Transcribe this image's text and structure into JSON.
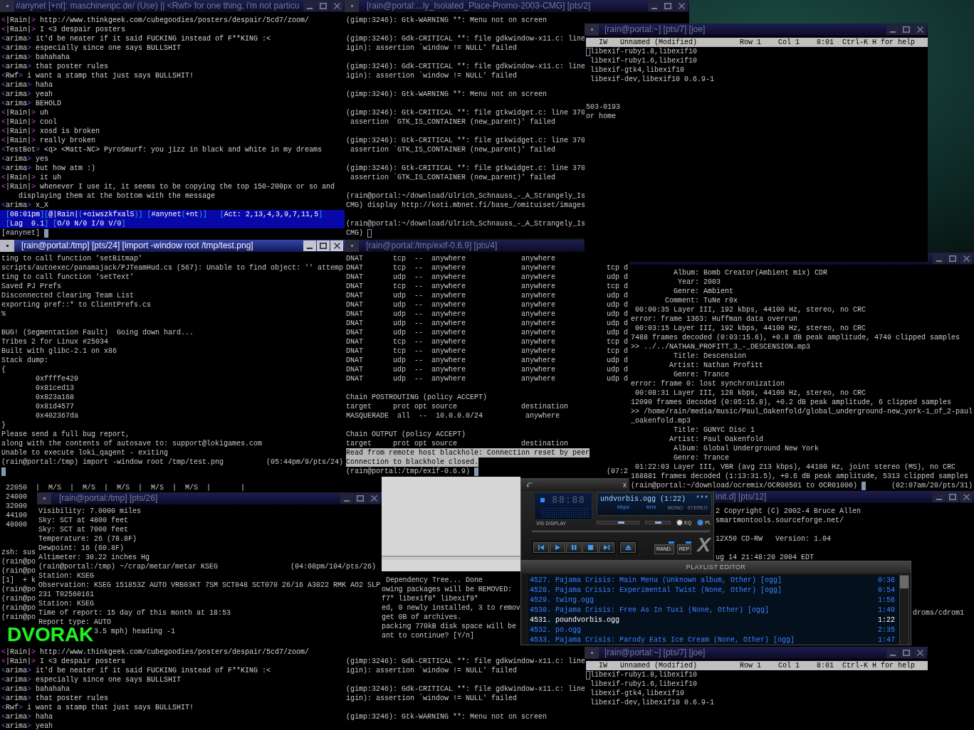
{
  "windows": [
    {
      "kind": "irc",
      "title": "#anynet [+nt]: maschinenpc.de/ (Use) || <Rwf> for one thing, i'm not particu",
      "focused": false,
      "messages": [
        {
          "nick": "<|Rain|>",
          "own": true,
          "text": "http://www.thinkgeek.com/cubegoodies/posters/despair/5cd7/zoom/"
        },
        {
          "nick": "<|Rain|>",
          "own": true,
          "text": "I <3 despair posters"
        },
        {
          "nick": "<arima>",
          "own": false,
          "text": "it'd be neater if it said FUCKING instead of F**KING :<"
        },
        {
          "nick": "<arima>",
          "own": false,
          "text": "especially since one says BULLSHIT"
        },
        {
          "nick": "<arima>",
          "own": false,
          "text": "bahahaha"
        },
        {
          "nick": "<arima>",
          "own": false,
          "text": "that poster rules"
        },
        {
          "nick": "<Rwf>",
          "own": false,
          "text": "i want a stamp that just says BULLSHIT!"
        },
        {
          "nick": "<arima>",
          "own": false,
          "text": "haha"
        },
        {
          "nick": "<arima>",
          "own": false,
          "text": "yeah"
        },
        {
          "nick": "<arima>",
          "own": false,
          "text": "BEHOLD"
        },
        {
          "nick": "<|Rain|>",
          "own": true,
          "text": "uh"
        },
        {
          "nick": "<|Rain|>",
          "own": true,
          "text": "cool"
        },
        {
          "nick": "<|Rain|>",
          "own": true,
          "text": "xosd is broken"
        },
        {
          "nick": "<|Rain|>",
          "own": true,
          "text": "really broken"
        },
        {
          "nick": "<TestBot>",
          "own": false,
          "text": "<q> <Matt-NC> PyroSmurf: you jizz in black and white in my dreams"
        },
        {
          "nick": "<arima>",
          "own": false,
          "text": "yes"
        },
        {
          "nick": "<arima>",
          "own": false,
          "text": "but how atm :)"
        },
        {
          "nick": "<|Rain|>",
          "own": true,
          "text": "it uh"
        },
        {
          "nick": "<|Rain|>",
          "own": true,
          "text": "whenever I use it, it seems to be copying the top 150-200px or so and displaying them at the bottom with the message"
        },
        {
          "nick": "<arima>",
          "own": false,
          "text": "x_X"
        }
      ],
      "status_lines": [
        "[08:01pm][@|Rain|(+oiwszkfxalS)] [#anynet(+nt)]   [Act: 2,13,4,3,9,7,11,5]",
        "[Lag  0.1] [O/0 N/0 I/0 V/0]"
      ],
      "input": {
        "text": "[#anynet]",
        "cursor": true
      }
    },
    {
      "kind": "terminal",
      "title": "[rain@portal:...ly_Isolated_Place-Promo-2003-CMG] [pts/2]",
      "focused": false,
      "blocks": [
        [
          "(gimp:3246): Gtk-WARNING **: Menu not on screen"
        ],
        [
          "(gimp:3246): Gdk-CRITICAL **: file gdkwindow-x11.c: line",
          "igin): assertion `window != NULL' failed"
        ],
        [
          "(gimp:3246): Gdk-CRITICAL **: file gdkwindow-x11.c: line",
          "igin): assertion `window != NULL' failed"
        ],
        [
          "(gimp:3246): Gtk-WARNING **: Menu not on screen"
        ],
        [
          "(gimp:3246): Gtk-CRITICAL **: file gtkwidget.c: line 370",
          " assertion `GTK_IS_CONTAINER (new_parent)' failed"
        ],
        [
          "(gimp:3246): Gtk-CRITICAL **: file gtkwidget.c: line 370",
          " assertion `GTK_IS_CONTAINER (new_parent)' failed"
        ],
        [
          "(gimp:3246): Gtk-CRITICAL **: file gtkwidget.c: line 370",
          " assertion `GTK_IS_CONTAINER (new_parent)' failed"
        ],
        [
          "(rain@portal:~/download/Ulrich_Schnauss_-_A_Strangely_Is",
          "CMG) display http://koti.mbnet.fi/base_/omituiset/images"
        ],
        [
          "(rain@portal:~/download/Ulrich_Schnauss_-_A_Strangely_Is"
        ]
      ],
      "prompt": {
        "text": "CMG)",
        "cursor": true,
        "cursor_below": false,
        "cursor_outline": true
      }
    },
    {
      "kind": "editor",
      "title": "[rain@portal:~] [pts/7] [joe]",
      "focused": false,
      "status_line": "IW   Unnamed (Modified)          Row 1    Col 1    8:01  Ctrl-K H for help",
      "buffer": [
        "libexif-ruby1.8,libexif10",
        "libexif-ruby1.6,libexif10",
        "libexif-gtk4,libexif10",
        "libexif-dev,libexif10 0.6.9-1"
      ],
      "cursor": true,
      "cursor_outline": true,
      "leftover_lines": [
        "503-0193",
        "or home"
      ]
    },
    {
      "kind": "terminal",
      "title": "[rain@portal:/tmp] [pts/24] [import -window root /tmp/test.png]",
      "focused": true,
      "blocks": [
        [
          "ting to call function 'setBitmap'",
          "scripts/autoexec/panamajack/PJTeamHud.cs (567): Unable to find object: '' attemp",
          "ting to call function 'setText'",
          "Saved PJ Prefs",
          "Disconnected Clearing Team List",
          "exporting pref::* to ClientPrefs.cs",
          "%"
        ],
        [
          "BUG! (Segmentation Fault)  Going down hard...",
          "Tribes 2 for Linux #25034",
          "Built with glibc-2.1 on x86",
          "Stack dump:",
          "{",
          "        0xffffe420",
          "        0x81ced13",
          "        0x823a168",
          "        0x81d4577",
          "        0x402367da",
          "}",
          "Please send a full bug report,",
          "along with the contents of autosave to: support@lokigames.com",
          "Unable to execute loki_qagent - exiting"
        ]
      ],
      "prompt": {
        "text": "(rain@portal:/tmp) import -window root /tmp/test.png",
        "time": "(05:44pm/9/pts/24)",
        "cursor": true,
        "cursor_below": true,
        "cursor_outline": false
      }
    },
    {
      "kind": "terminal",
      "title": "[rain@portal:/tmp/exif-0.6.9] [pts/4]",
      "focused": false,
      "blocks": [
        [
          "DNAT       tcp  --  anywhere             anywhere",
          "DNAT       tcp  --  anywhere             anywhere            tcp d",
          "DNAT       udp  --  anywhere             anywhere            udp d",
          "DNAT       tcp  --  anywhere             anywhere            tcp d",
          "DNAT       udp  --  anywhere             anywhere            udp d",
          "DNAT       udp  --  anywhere             anywhere            udp d",
          "DNAT       udp  --  anywhere             anywhere            udp d",
          "DNAT       udp  --  anywhere             anywhere            udp d",
          "DNAT       udp  --  anywhere             anywhere            udp d",
          "DNAT       tcp  --  anywhere             anywhere            tcp d",
          "DNAT       tcp  --  anywhere             anywhere            tcp d",
          "DNAT       udp  --  anywhere             anywhere            udp d",
          "DNAT       udp  --  anywhere             anywhere            udp d",
          "DNAT       udp  --  anywhere             anywhere            udp d"
        ],
        [
          "Chain POSTROUTING (policy ACCEPT)",
          "target     prot opt source               destination",
          "MASQUERADE  all  --  10.0.0.0/24          anywhere"
        ],
        [
          "Chain OUTPUT (policy ACCEPT)",
          "target     prot opt source               destination"
        ]
      ],
      "selected_lines": [
        "Read from remote host blackhole: Connection reset by peer",
        "Connection to blackhole closed."
      ],
      "prompt": {
        "text": "(rain@portal:/tmp/exif-0.6.9)",
        "time": "(07:2",
        "cursor": true,
        "cursor_below": false,
        "cursor_outline": false
      }
    },
    {
      "kind": "terminal",
      "title_bar": true,
      "focused": false,
      "blocks": [
        [
          "          Album: Bomb Creator(Ambient mix) CDR",
          "           Year: 2003",
          "          Genre: Ambient",
          "        Comment: TuNe r0x",
          " 00:00:35 Layer III, 192 kbps, 44100 Hz, stereo, no CRC",
          "error: frame 1363: Huffman data overrun",
          " 00:03:15 Layer III, 192 kbps, 44100 Hz, stereo, no CRC",
          "7488 frames decoded (0:03:15.6), +0.8 dB peak amplitude, 4749 clipped samples",
          ">> ../../NATHAN_PROFITT_3_-_DESCENSION.mp3",
          "          Title: Descension",
          "         Artist: Nathan Profitt",
          "          Genre: Trance",
          "error: frame 0: lost synchronization",
          " 00:08:31 Layer III, 128 kbps, 44100 Hz, stereo, no CRC",
          "12090 frames decoded (0:05:15.8), +0.2 dB peak amplitude, 6 clipped samples",
          ">> /home/rain/media/music/Paul_Oakenfold/global_underground-new_york-1_of_2-paul",
          "_oakenfold.mp3",
          "          Title: GUNYC Disc 1",
          "         Artist: Paul Oakenfold",
          "          Album: Global Underground New York",
          "          Genre: Trance",
          " 01:22:03 Layer III, VBR (avg 213 kbps), 44100 Hz, joint stereo (MS), no CRC",
          "168881 frames decoded (1:13:31.5), +0.6 dB peak amplitude, 5313 clipped samples"
        ]
      ],
      "prompt": {
        "text": "(rain@portal:~/download/ocremix/OCR00501 to OCR01000)",
        "time": "(02:07am/20/pts/31)",
        "cursor": true,
        "cursor_below": false,
        "cursor_outline": false
      }
    },
    {
      "kind": "terminal",
      "blocks": [
        [
          " 22050  |  M/S  |  M/S  |  M/S  |  M/S  |  M/S  |       |",
          " 24000",
          " 32000",
          " 44100",
          " 48000"
        ],
        [
          "zsh: sus",
          "(rain@po",
          "(rain@po",
          "[1]  + k",
          "(rain@po",
          "(rain@po",
          "(rain@po",
          "(rain@po"
        ]
      ]
    },
    {
      "kind": "terminal",
      "title": "[rain@portal:/tmp] [pts/26]",
      "focused": false,
      "blocks": [
        [
          "Visibility: 7.0000 miles",
          "Sky: SCT at 4800 feet",
          "Sky: SCT at 7000 feet",
          "Temperature: 26 (78.8F)",
          "Dewpoint: 16 (60.8F)",
          "Altimeter: 30.22 inches Hg",
          "(rain@portal:/tmp) ~/crap/metar/metar KSEG                 (04:08pm/104/pts/26)",
          "Station: KSEG",
          "Observation: KSEG 151853Z AUTO VRB03KT 7SM SCT048 SCT070 26/16 A3022 RMK AO2 SLP",
          "231 T02560161",
          "Station: KSEG",
          "Time of report: 15 day of this month at 18:53",
          "Report type: AUTO",
          "             3.5 mph) heading -1"
        ]
      ]
    },
    {
      "kind": "blank"
    },
    {
      "kind": "player",
      "title_fragment": "x",
      "time_display": "88:88",
      "vis_label": "VIS DISPLAY",
      "song_title": "undvorbis.ogg (1:22)",
      "rating": "***",
      "bitrate_label": "kbps",
      "rate_label": "kHz",
      "channel_labels": [
        "MONO",
        "STEREO"
      ],
      "volume": {
        "level": 0.6
      },
      "balance": {
        "level": 0.5
      },
      "toggles": [
        {
          "label": "EQ",
          "on": false
        },
        {
          "label": "PL",
          "on": true
        }
      ],
      "mode_buttons": [
        {
          "label": "RAND.",
          "on": true
        },
        {
          "label": "REP",
          "on": true
        }
      ],
      "logo": "X"
    },
    {
      "kind": "terminal",
      "title": "init.d] [pts/12]",
      "focused": false,
      "blocks": [
        [
          "2 Copyright (C) 2002-4 Bruce Allen",
          "smartmontools.sourceforge.net/"
        ],
        [
          "12X50 CD-RW   Version: 1.04"
        ],
        [
          "ug 14 21:48:20 2004 EDT"
        ]
      ],
      "partly_covered_line": "droms/cdrom1"
    },
    {
      "kind": "terminal",
      "blocks": [
        [
          " Dependency Tree... Done",
          "owing packages will be REMOVED:",
          "f7* libexif8* libexif9*",
          "ed, 0 newly installed, 3 to remov",
          "get 0B of archives.",
          "packing 770kB disk space will be",
          "ant to continue? [Y/n]"
        ]
      ]
    },
    {
      "kind": "playlist",
      "title": "PLAYLIST EDITOR",
      "entries": [
        {
          "text": "4527. Pajama Crisis: Main Menu (Unknown album, Other) [ogg]",
          "duration": "0:36",
          "playing": false
        },
        {
          "text": "4528. Pajama Crisis: Experimental Twist (None, Other) [ogg]",
          "duration": "0:54",
          "playing": false
        },
        {
          "text": "4529. twing.ogg",
          "duration": "1:56",
          "playing": false
        },
        {
          "text": "4530. Pajama Crisis: Free As In Tuxi (None, Other) [ogg]",
          "duration": "1:49",
          "playing": false
        },
        {
          "text": "4531. poundvorbis.ogg",
          "duration": "1:22",
          "playing": true
        },
        {
          "text": "4532. po.ogg",
          "duration": "2:35",
          "playing": false
        },
        {
          "text": "4533. Pajama Crisis: Parody Eats Ice Cream (None, Other) [ogg]",
          "duration": "1:47",
          "playing": false
        }
      ]
    },
    {
      "kind": "irc",
      "messages": [
        {
          "nick": "<|Rain|>",
          "own": true,
          "text": "http://www.thinkgeek.com/cubegoodies/posters/despair/5cd7/zoom/"
        },
        {
          "nick": "<|Rain|>",
          "own": true,
          "text": "I <3 despair posters"
        },
        {
          "nick": "<arima>",
          "own": false,
          "text": "it'd be neater if it said FUCKING instead of F**KING :<"
        },
        {
          "nick": "<arima>",
          "own": false,
          "text": "especially since one says BULLSHIT"
        },
        {
          "nick": "<arima>",
          "own": false,
          "text": "bahahaha"
        },
        {
          "nick": "<arima>",
          "own": false,
          "text": "that poster rules"
        },
        {
          "nick": "<Rwf>",
          "own": false,
          "text": "i want a stamp that just says BULLSHIT!"
        },
        {
          "nick": "<arima>",
          "own": false,
          "text": "haha"
        },
        {
          "nick": "<arima>",
          "own": false,
          "text": "yeah"
        }
      ]
    },
    {
      "kind": "terminal",
      "blocks": [
        [
          "(gimp:3246): Gdk-CRITICAL **: file gdkwindow-x11.c: line",
          "igin): assertion `window != NULL' failed"
        ],
        [
          "(gimp:3246): Gdk-CRITICAL **: file gdkwindow-x11.c: line",
          "igin): assertion `window != NULL' failed"
        ],
        [
          "(gimp:3246): Gtk-WARNING **: Menu not on screen"
        ]
      ]
    },
    {
      "kind": "editor",
      "title": "[rain@portal:~] [pts/7] [joe]",
      "focused": false,
      "status_line": "IW   Unnamed (Modified)          Row 1    Col 1    8:01  Ctrl-K H for help",
      "buffer": [
        "libexif-ruby1.8,libexif10",
        "libexif-ruby1.6,libexif10",
        "libexif-gtk4,libexif10",
        "libexif-dev,libexif10 0.6.9-1"
      ],
      "cursor": true,
      "cursor_outline": true
    }
  ],
  "osd": {
    "text": "DVORAK"
  }
}
